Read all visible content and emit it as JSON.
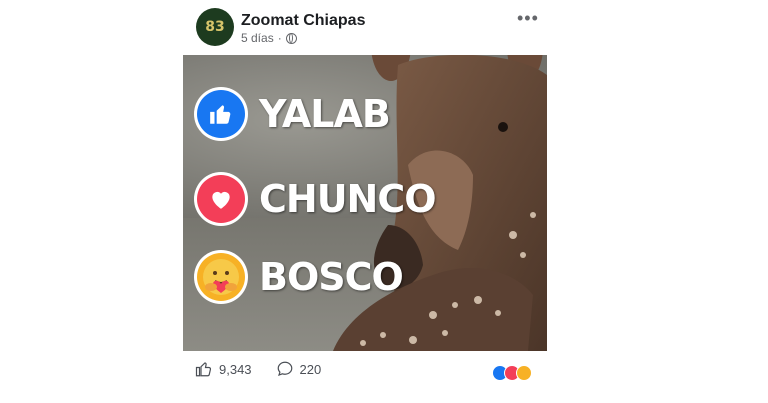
{
  "post": {
    "page_name": "Zoomat Chiapas",
    "time": "5 días",
    "separator": "·",
    "more_icon": "more-horizontal-icon",
    "avatar_text": "83"
  },
  "image": {
    "reactions": [
      {
        "name": "YALAB",
        "icon": "like-reaction-icon",
        "color": "#1877f2"
      },
      {
        "name": "CHUNCO",
        "icon": "love-reaction-icon",
        "color": "#f33e58"
      },
      {
        "name": "BOSCO",
        "icon": "care-reaction-icon",
        "color": "#f7b125"
      }
    ]
  },
  "footer": {
    "likes": "9,343",
    "comments": "220"
  },
  "colors": {
    "text": "#1c1e21",
    "muted": "#65676b"
  }
}
